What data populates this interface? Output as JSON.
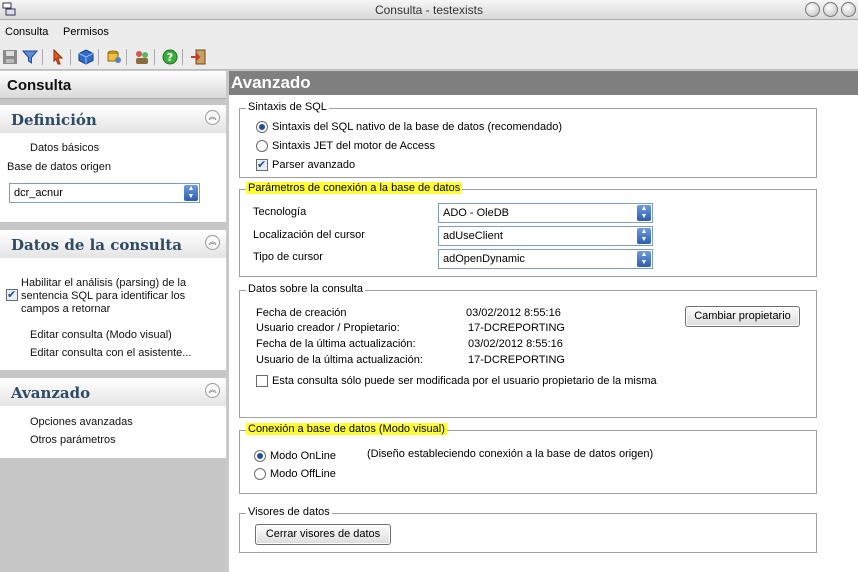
{
  "window": {
    "title": "Consulta - testexists"
  },
  "menu": {
    "items": [
      "Consulta",
      "Permisos"
    ]
  },
  "toolbar": {
    "icons": [
      "save-icon",
      "filter-icon",
      "pointer-icon",
      "cube-icon",
      "db-user-icon",
      "users-icon",
      "help-icon",
      "exit-icon"
    ]
  },
  "sidebar": {
    "header": "Consulta",
    "definicion": {
      "title": "Definición",
      "link_basic": "Datos básicos",
      "db_label": "Base de datos origen",
      "db_value": "dcr_acnur"
    },
    "datos_consulta": {
      "title": "Datos de la consulta",
      "parsing_label": "Habilitar el análisis (parsing) de la sentencia SQL para identificar los campos a retornar",
      "parsing_line1": "Habilitar el análisis (parsing) de la",
      "parsing_line2": "sentencia SQL para identificar los",
      "parsing_line3": "campos a retornar",
      "link_visual": "Editar consulta (Modo visual)",
      "link_wizard": "Editar consulta con el asistente..."
    },
    "avanzado": {
      "title": "Avanzado",
      "link_options": "Opciones avanzadas",
      "link_params": "Otros parámetros"
    }
  },
  "main": {
    "title": "Avanzado",
    "sql": {
      "legend": "Sintaxis de SQL",
      "opt_native": "Sintaxis del SQL nativo de la base de datos (recomendado)",
      "opt_jet": "Sintaxis JET del motor de Access",
      "parser": "Parser avanzado"
    },
    "connection": {
      "legend": "Parámetros de conexión a la base de datos",
      "tech_label": "Tecnología",
      "tech_value": "ADO - OleDB",
      "cursor_loc_label": "Localización del cursor",
      "cursor_loc_value": "adUseClient",
      "cursor_type_label": "Tipo de cursor",
      "cursor_type_value": "adOpenDynamic"
    },
    "info": {
      "legend": "Datos sobre la consulta",
      "created_label": "Fecha de creación",
      "created_value": "03/02/2012 8:55:16",
      "owner_label": "Usuario creador / Propietario:",
      "owner_value": "17-DCREPORTING",
      "updated_label": "Fecha de la última actualización:",
      "updated_value": "03/02/2012 8:55:16",
      "updater_label": "Usuario de la última actualización:",
      "updater_value": "17-DCREPORTING",
      "change_owner": "Cambiar propietario",
      "owner_only": "Esta consulta sólo puede ser modificada por el usuario propietario de la misma"
    },
    "visual": {
      "legend": "Conexión a base de datos (Modo visual)",
      "online": "Modo OnLine",
      "online_desc": "(Diseño estableciendo conexión a la base de datos origen)",
      "offline": "Modo OffLine"
    },
    "viewers": {
      "legend": "Visores de datos",
      "close": "Cerrar visores de datos"
    }
  },
  "colors": {
    "highlight": "#ffff33",
    "header_gray": "#7f7f7f",
    "panel_title": "#2f4a64"
  }
}
